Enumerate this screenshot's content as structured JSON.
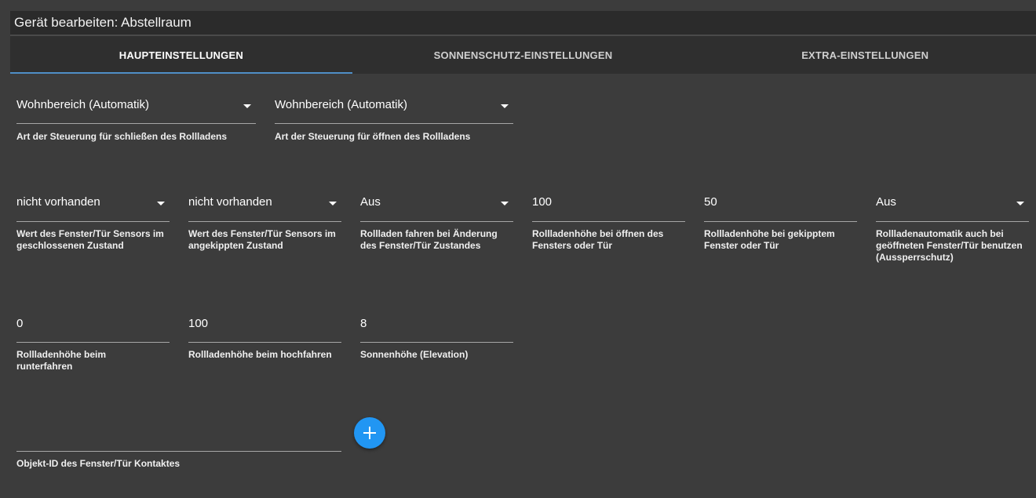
{
  "window": {
    "title": "Gerät bearbeiten: Abstellraum"
  },
  "tabs": [
    {
      "label": "HAUPTEINSTELLUNGEN",
      "active": true
    },
    {
      "label": "SONNENSCHUTZ-EINSTELLUNGEN",
      "active": false
    },
    {
      "label": "EXTRA-EINSTELLUNGEN",
      "active": false
    }
  ],
  "row1": [
    {
      "value": "Wohnbereich (Automatik)",
      "label": "Art der Steuerung für schließen des Rollladens",
      "type": "select"
    },
    {
      "value": "Wohnbereich (Automatik)",
      "label": "Art der Steuerung für öffnen des Rollladens",
      "type": "select"
    }
  ],
  "row2": [
    {
      "value": "nicht vorhanden",
      "label": "Wert des Fenster/Tür Sensors im geschlossenen Zustand",
      "type": "select"
    },
    {
      "value": "nicht vorhanden",
      "label": "Wert des Fenster/Tür Sensors im angekippten Zustand",
      "type": "select"
    },
    {
      "value": "Aus",
      "label": "Rollladen fahren bei Änderung des Fenster/Tür Zustandes",
      "type": "select"
    },
    {
      "value": "100",
      "label": "Rollladenhöhe bei öffnen des Fensters oder Tür",
      "type": "input"
    },
    {
      "value": "50",
      "label": "Rollladenhöhe bei gekipptem Fenster oder Tür",
      "type": "input"
    },
    {
      "value": "Aus",
      "label": "Rollladenautomatik auch bei geöffneten Fenster/Tür benutzen (Aussperrschutz)",
      "type": "select"
    }
  ],
  "row3": [
    {
      "value": "0",
      "label": "Rollladenhöhe beim runterfahren",
      "type": "input"
    },
    {
      "value": "100",
      "label": "Rollladenhöhe beim hochfahren",
      "type": "input"
    },
    {
      "value": "8",
      "label": "Sonnenhöhe (Elevation)",
      "type": "input"
    }
  ],
  "object_id": {
    "value": "",
    "label": "Objekt-ID des Fenster/Tür Kontaktes"
  },
  "icons": {
    "add": "plus-icon",
    "dropdown": "chevron-down-icon"
  },
  "colors": {
    "accent": "#2196f3",
    "tab_indicator": "#4f8fc7",
    "background": "#3c3c3c"
  }
}
